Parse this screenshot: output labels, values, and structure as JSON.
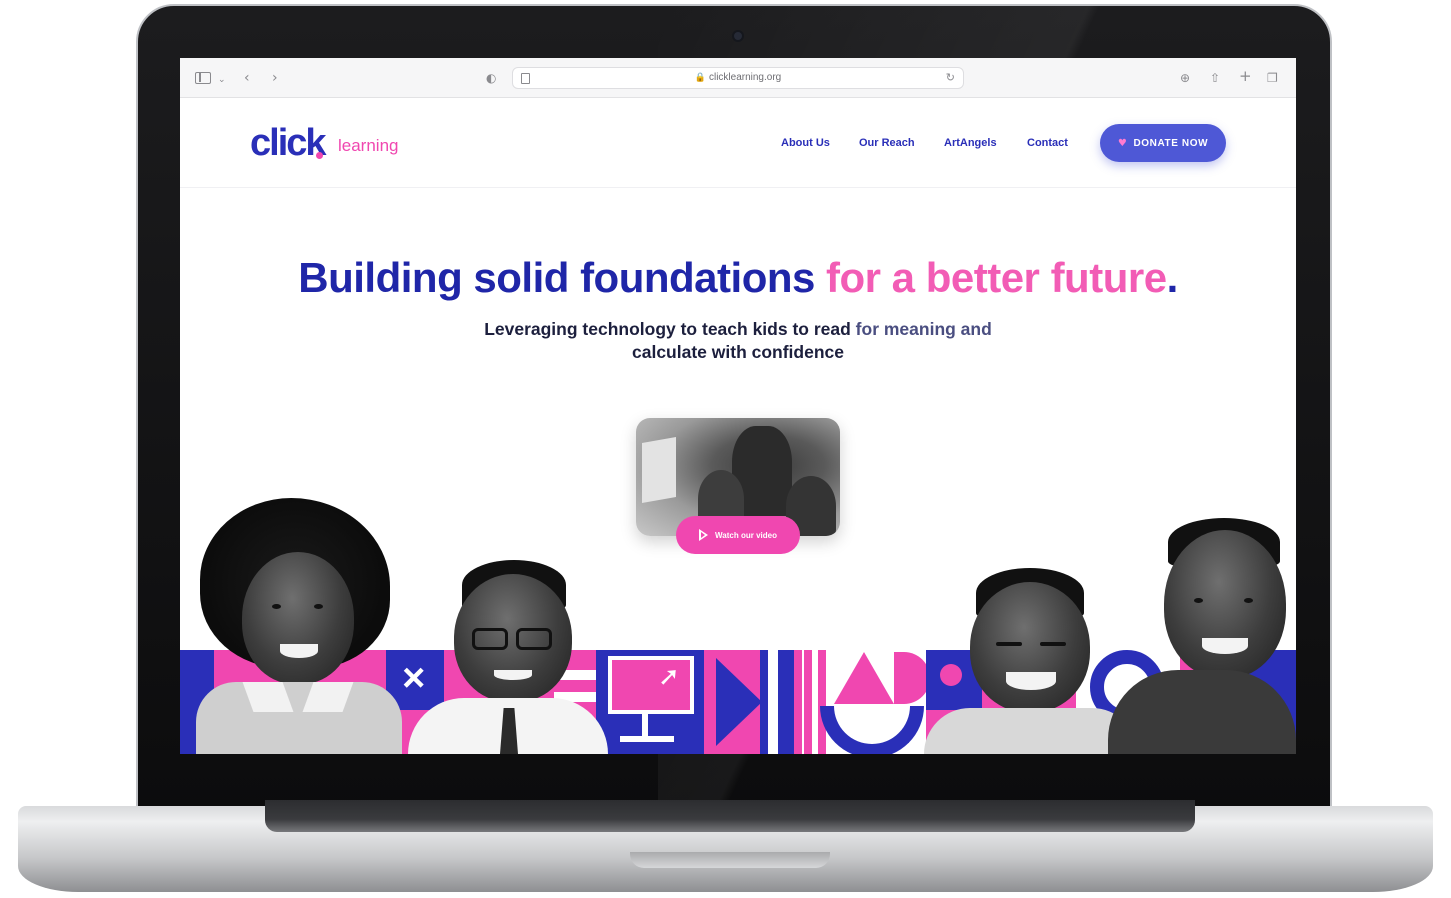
{
  "browser": {
    "url": "clicklearning.org"
  },
  "site": {
    "logo_main": "click",
    "logo_sub": "learning",
    "nav": [
      "About Us",
      "Our Reach",
      "ArtAngels",
      "Contact"
    ],
    "donate_label": "DONATE NOW"
  },
  "hero": {
    "headline_part1": "Building solid foundations",
    "headline_part2": "for a better future",
    "headline_period": ".",
    "sub_line1_strong": "Leveraging technology to teach kids to read",
    "sub_line1_light": "for meaning and",
    "sub_line2": "calculate with confidence",
    "video_button": "Watch our video"
  },
  "colors": {
    "brand_blue": "#2a2fb8",
    "brand_pink": "#f047b0",
    "donate_bg": "#4e58d6"
  }
}
